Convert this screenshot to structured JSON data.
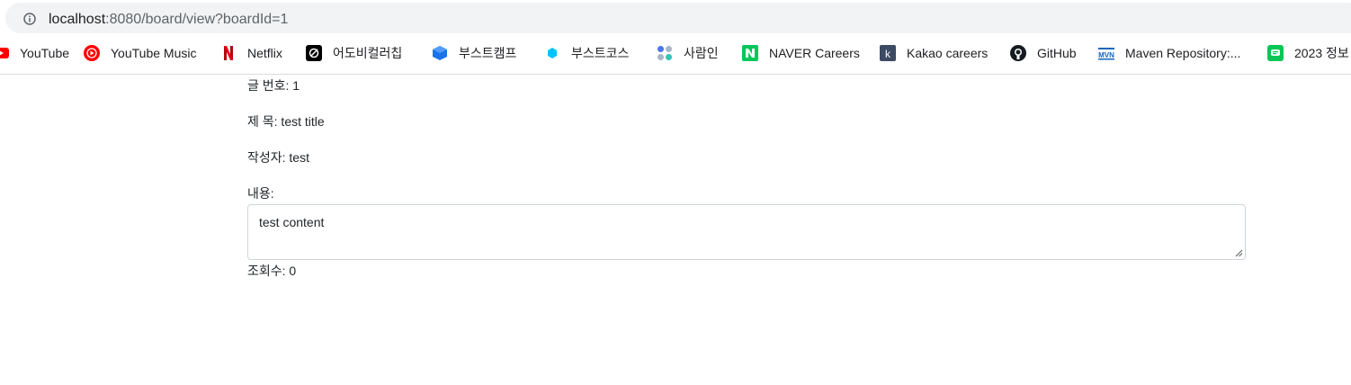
{
  "browser": {
    "url_host": "localhost",
    "url_rest": ":8080/board/view?boardId=1",
    "bookmarks": [
      {
        "label": "YouTube",
        "icon": "youtube-icon"
      },
      {
        "label": "YouTube Music",
        "icon": "youtube-music-icon"
      },
      {
        "label": "Netflix",
        "icon": "netflix-icon"
      },
      {
        "label": "어도비컬러칩",
        "icon": "adobe-color-icon"
      },
      {
        "label": "부스트캠프",
        "icon": "boostcamp-icon"
      },
      {
        "label": "부스트코스",
        "icon": "boostcourse-icon"
      },
      {
        "label": "사람인",
        "icon": "saramin-icon"
      },
      {
        "label": "NAVER Careers",
        "icon": "naver-icon"
      },
      {
        "label": "Kakao careers",
        "icon": "kakao-icon"
      },
      {
        "label": "GitHub",
        "icon": "github-icon"
      },
      {
        "label": "Maven Repository:...",
        "icon": "maven-icon"
      },
      {
        "label": "2023 정보",
        "icon": "line-icon"
      }
    ]
  },
  "post": {
    "number": "글 번호: 1",
    "title": "제 목: test title",
    "author": "작성자: test",
    "content_label": "내용:",
    "content": "test content",
    "views": "조회수: 0"
  },
  "colors": {
    "youtube_red": "#ff0000",
    "netflix_red": "#e50914",
    "naver_green": "#03c75a",
    "boostcamp_blue": "#1a73e8",
    "omnibox_bg": "#f1f3f4"
  }
}
